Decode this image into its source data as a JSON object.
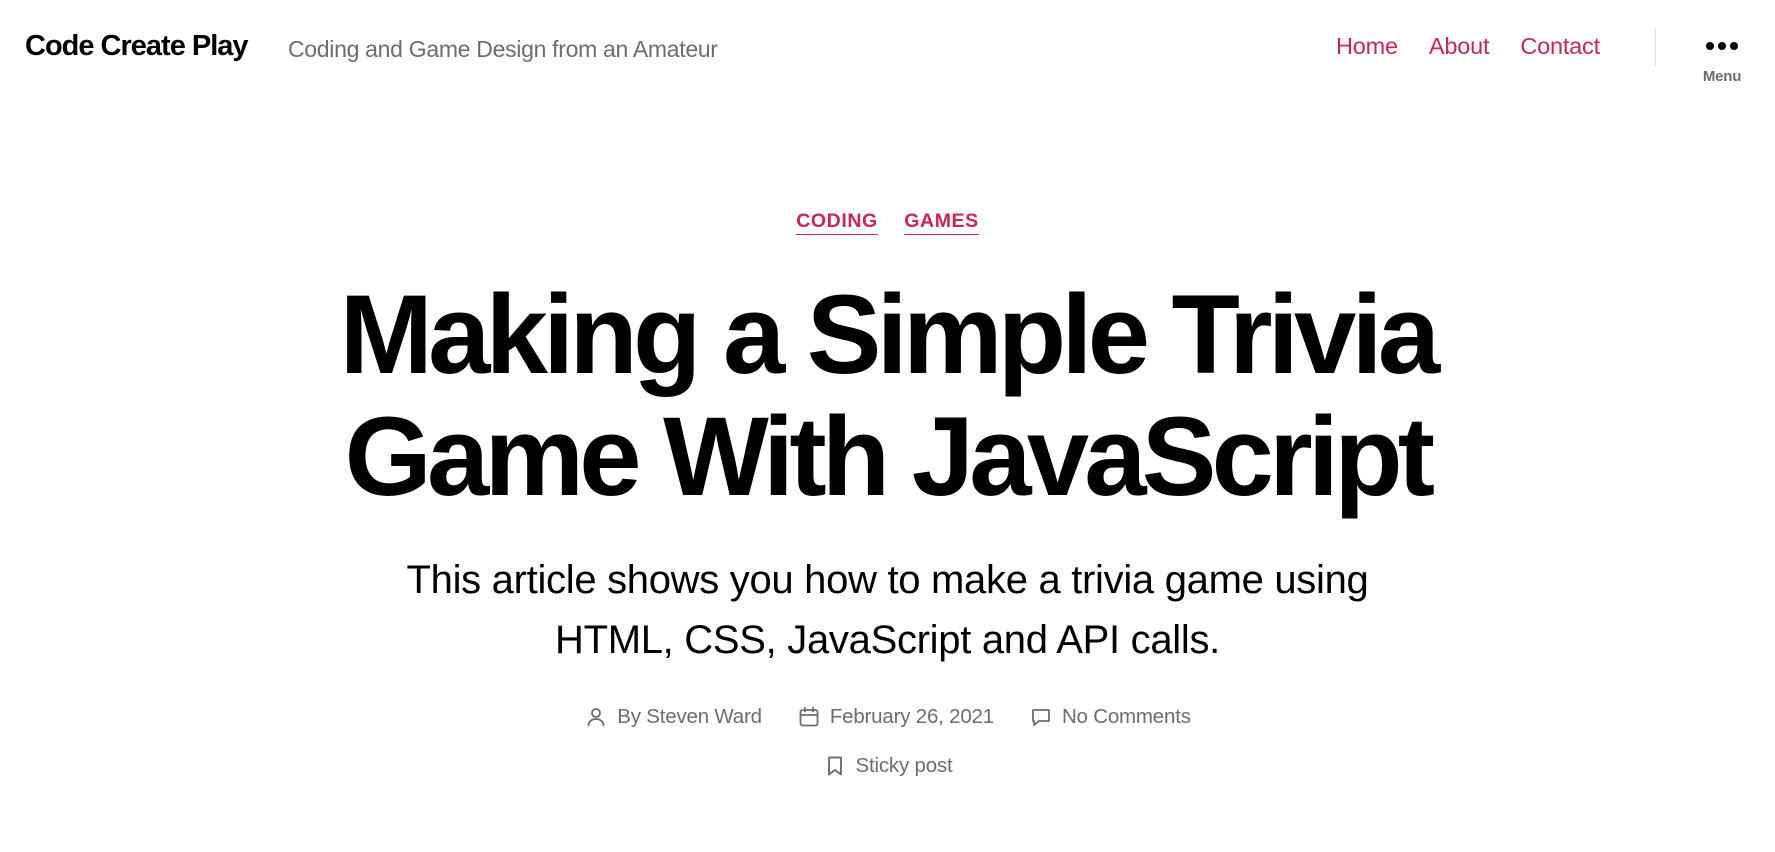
{
  "header": {
    "site_title": "Code Create Play",
    "tagline": "Coding and Game Design from an Amateur",
    "nav": [
      {
        "label": "Home"
      },
      {
        "label": "About"
      },
      {
        "label": "Contact"
      }
    ],
    "menu_label": "Menu",
    "menu_icon": "ellipsis-icon"
  },
  "entry": {
    "categories": [
      {
        "label": "CODING"
      },
      {
        "label": "GAMES"
      }
    ],
    "title_lines": [
      "Making a Simple Trivia",
      "Game With JavaScript"
    ],
    "intro_lines": [
      "This article shows you how to make a trivia game using",
      "HTML, CSS, JavaScript and API calls."
    ],
    "meta": {
      "author": "By Steven Ward",
      "date": "February 26, 2021",
      "comments": "No Comments",
      "sticky": "Sticky post"
    }
  },
  "colors": {
    "accent": "#cd2653",
    "text": "#000000",
    "secondary_text": "#6d6d6d",
    "background": "#ffffff"
  }
}
